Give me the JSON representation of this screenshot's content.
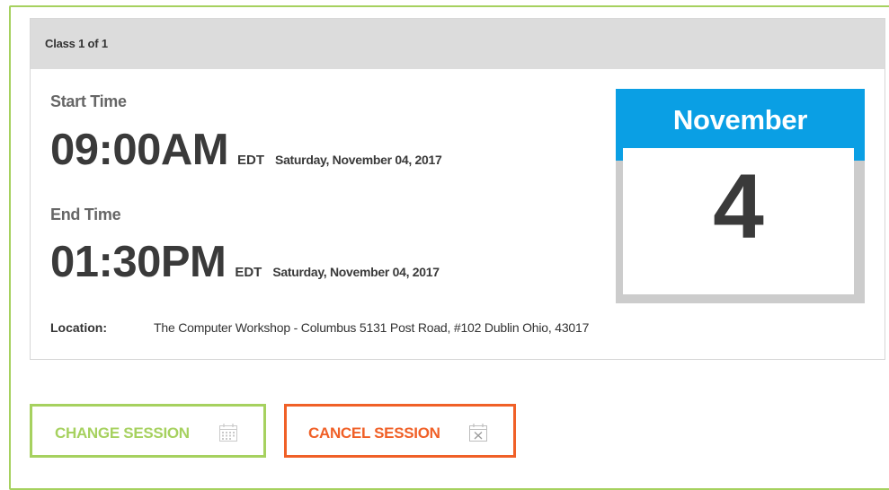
{
  "header": {
    "class_count": "Class 1 of 1"
  },
  "start": {
    "label": "Start Time",
    "time": "09:00AM",
    "timezone": "EDT",
    "date": "Saturday, November 04, 2017"
  },
  "end": {
    "label": "End Time",
    "time": "01:30PM",
    "timezone": "EDT",
    "date": "Saturday, November 04, 2017"
  },
  "location": {
    "label": "Location:",
    "value": "The Computer Workshop - Columbus 5131 Post Road, #102 Dublin Ohio, 43017"
  },
  "calendar": {
    "month": "November",
    "day": "4"
  },
  "actions": {
    "change_label": "CHANGE SESSION",
    "change_icon": "calendar-icon",
    "cancel_label": "CANCEL SESSION",
    "cancel_icon": "calendar-cancel-icon"
  },
  "colors": {
    "accent_green": "#a6d15f",
    "accent_orange": "#f06027",
    "calendar_blue": "#0a9fe4",
    "header_gray": "#dcdcdc"
  }
}
